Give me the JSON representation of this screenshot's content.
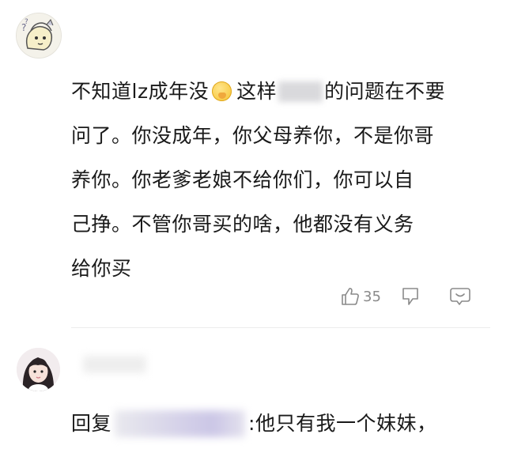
{
  "comment": {
    "lines": [
      {
        "before": "不知道lz成年没",
        "emoji": "smirk-emoji",
        "after_emoji": "这样",
        "after_redact": "的问题在不要"
      },
      {
        "text": "问了。你没成年，你父母养你，不是你哥"
      },
      {
        "text": "养你。你老爹老娘不给你们，你可以自"
      },
      {
        "text": "己挣。不管你哥买的啥，他都没有义务"
      },
      {
        "text": "给你买"
      }
    ],
    "like_count": "35"
  },
  "reply": {
    "prefix": "回复",
    "text": ":他只有我一个妹妹，"
  },
  "icons": {
    "like": "thumbs-up-icon",
    "dislike": "thumbs-down-icon",
    "comment": "comment-bubble-icon"
  },
  "colors": {
    "text": "#1a1a1a",
    "action_icon": "#8a8a8a",
    "divider": "#ececec"
  }
}
